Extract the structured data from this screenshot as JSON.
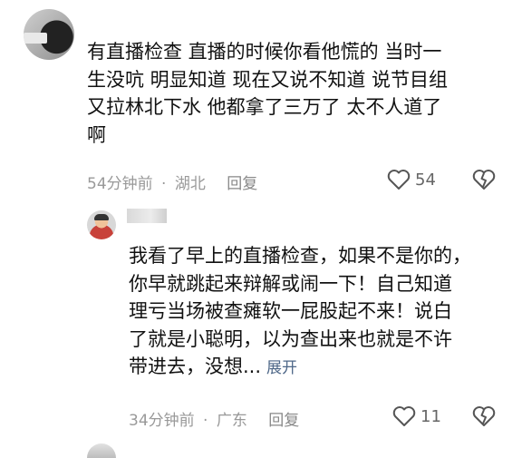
{
  "comments": [
    {
      "text_lines": [
        "有直播检查 直播的时候你看他慌的 当时一",
        "生没吭 明显知道 现在又说不知道 说节目组",
        "又拉林北下水 他都拿了三万了 太不人道了",
        "啊"
      ],
      "time": "54分钟前",
      "separator": "·",
      "location": "湖北",
      "reply_label": "回复",
      "likes": "54"
    },
    {
      "text_lines": [
        "我看了早上的直播检查，如果不是你的，",
        "你早就跳起来辩解或闹一下！自己知道",
        "理亏当场被查瘫软一屁股起不来！说白",
        "了就是小聪明，以为查出来也就是不许",
        "带进去，没想..."
      ],
      "expand_label": "展开",
      "time": "34分钟前",
      "separator": "·",
      "location": "广东",
      "reply_label": "回复",
      "likes": "11"
    }
  ],
  "icons": {
    "like": "heart-outline-icon",
    "dislike": "broken-heart-icon"
  },
  "colors": {
    "text": "#111111",
    "meta": "#999999",
    "link": "#4e6788"
  }
}
